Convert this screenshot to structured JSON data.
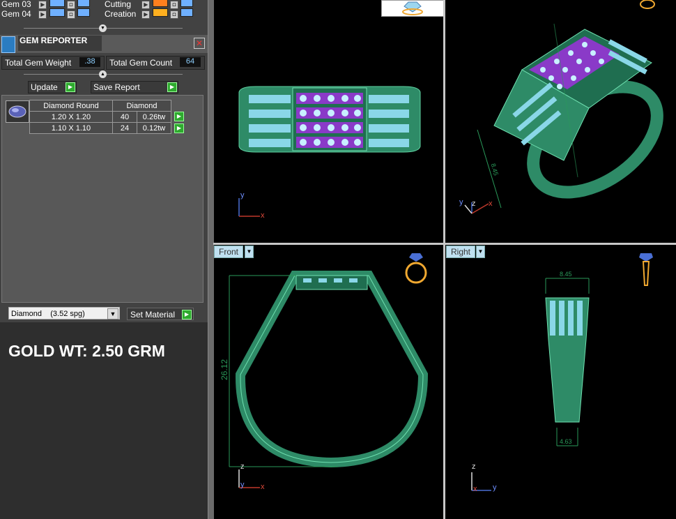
{
  "gem_rows": [
    {
      "label": "Gem 03",
      "color": "#6fb0ff"
    },
    {
      "label": "Gem 04",
      "color": "#6fb0ff"
    }
  ],
  "mode_rows": [
    {
      "label": "Cutting",
      "color": "#ff7f1e"
    },
    {
      "label": "Creation",
      "color": "#ffb020"
    }
  ],
  "reporter": {
    "title": "GEM REPORTER",
    "total_weight_label": "Total Gem Weight",
    "total_weight_value": ".38",
    "total_count_label": "Total Gem Count",
    "total_count_value": "64",
    "update_label": "Update",
    "save_label": "Save Report"
  },
  "gem_table": {
    "headers": [
      "Diamond Round",
      "Diamond"
    ],
    "rows": [
      {
        "size": "1.20 X 1.20",
        "count": "40",
        "weight": "0.26tw"
      },
      {
        "size": "1.10 X 1.10",
        "count": "24",
        "weight": "0.12tw"
      }
    ]
  },
  "material": {
    "selected": "Diamond    (3.52 spg)",
    "set_label": "Set Material"
  },
  "gold_weight": "GOLD WT: 2.50 GRM",
  "viewports": {
    "front_label": "Front",
    "right_label": "Right",
    "front_dim": "26.12",
    "right_top_dim": "8.45",
    "right_bottom_dim": "4.63",
    "persp_dim": "8.45"
  },
  "axes": {
    "x": "x",
    "y": "y",
    "z": "z"
  },
  "colors": {
    "ring": "#2e8b67",
    "stone": "#8ad7e8",
    "gem_purple": "#8a3ac8",
    "dim": "#2a9a5a",
    "axis_red": "#c0392b",
    "axis_blue": "#4a6fd4"
  }
}
